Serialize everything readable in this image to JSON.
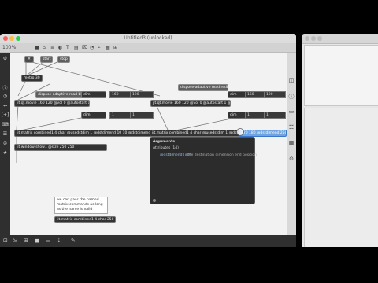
{
  "window": {
    "title": "Untitled3 (unlocked)",
    "zoom": "100%",
    "toolbar": [
      "■",
      "⌂",
      "≡",
      "◐",
      "T",
      "▤",
      "⌧",
      "◔",
      "⌁",
      "▦",
      "⊞"
    ]
  },
  "objects": {
    "toggle": "✕",
    "start": "start",
    "stop": "stop",
    "metro": "metro 30",
    "read1": "dispose-adaptive read blacksmov",
    "qtmovie1": "jit.qt.movie 160 120 @vol 0 @autostart 1 @unique 1",
    "dim1": "dim",
    "dim1a": "160",
    "dim1b": "120",
    "dim2": "dim",
    "dim2a": "1",
    "dim2b": "1",
    "read2": "dispose-adaptive read redball.mov",
    "qtmovie2": "jit.qt.movie 160 120 @vol 0 @autostart 1 @unique 1",
    "dim3": "dim",
    "dim3a": "160",
    "dim3b": "120",
    "dim4": "dim",
    "dim4a": "1",
    "dim4b": "1",
    "matrix1": "jit.matrix combined1 4 char @usedstdim 1 @dstdimend 10 10 @dstdimend 170 130",
    "matrix2": "jit.matrix combined1 4 char @usedstdim 1 @dstdimend",
    "matrix2sel": "120 180 @dstdimend 250",
    "window": "jit.window show1 @size 250 250",
    "comment": "we can pass the named\nmatrix commands as long\nas the name is valid",
    "matrix3": "jit.matrix combined1 4 char 250 250"
  },
  "popup": {
    "heading": "Arguments",
    "attributes": "Attributes (14)",
    "item_name": "@dstdimend [int]",
    "item_desc": "The destination dimension end position"
  },
  "leftbar": [
    "⚙",
    "ⓘ",
    "◔",
    "↔",
    "[+]",
    "⌨",
    "☰",
    "⊘",
    "★"
  ],
  "bottombar": [
    "⊡",
    "⇲",
    "⊞",
    "◼",
    "▭",
    "⇣",
    "✎"
  ],
  "rightwin": {
    "title": ""
  },
  "righttools": [
    "◫",
    "ⓘ",
    "▭",
    "☷",
    "▦",
    "⊙"
  ]
}
